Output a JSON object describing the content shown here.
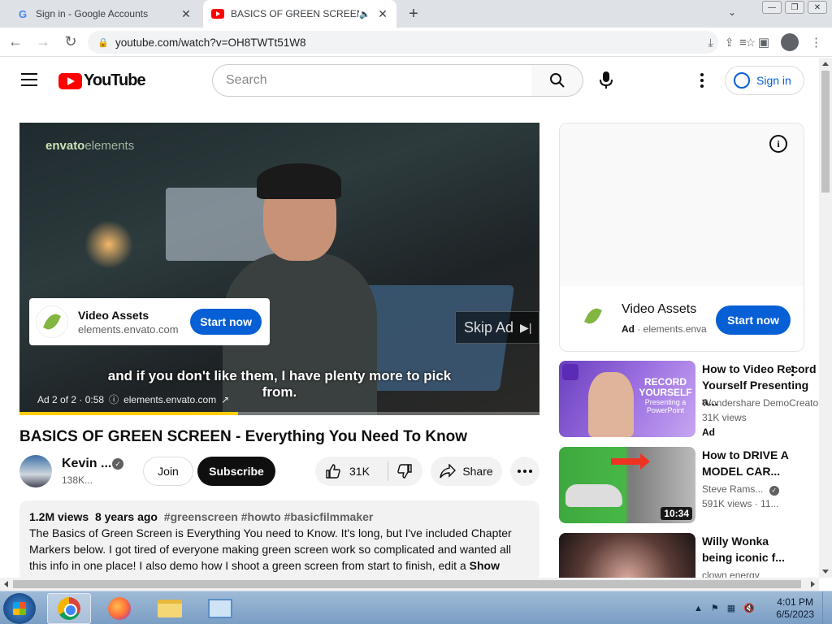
{
  "browser": {
    "tabs": [
      {
        "title": "Sign in - Google Accounts",
        "favicon": "google-g-icon"
      },
      {
        "title": "BASICS OF GREEN SCREEN -",
        "favicon": "youtube-icon",
        "audio": true
      }
    ],
    "url": "youtube.com/watch?v=OH8TWTt51W8"
  },
  "header": {
    "logo_text": "YouTube",
    "search_placeholder": "Search",
    "sign_in": "Sign in"
  },
  "player": {
    "brand_overlay": "envato",
    "brand_overlay_light": "elements",
    "ad_card": {
      "title": "Video Assets",
      "domain": "elements.envato.com",
      "cta": "Start now"
    },
    "skip_label": "Skip Ad",
    "caption_line1": "and if you don't like them, I have plenty more to pick",
    "caption_line2": "from.",
    "ad_status": "Ad 2 of 2 · 0:58",
    "ad_domain": "elements.envato.com",
    "progress": 0.42
  },
  "video": {
    "title": "BASICS OF GREEN SCREEN - Everything You Need To Know",
    "channel": "Kevin ...",
    "subscribers": "138K...",
    "join": "Join",
    "subscribe": "Subscribe",
    "likes": "31K",
    "share": "Share"
  },
  "description": {
    "views": "1.2M views",
    "age": "8 years ago",
    "tags": "#greenscreen #howto #basicfilmmaker",
    "line1": "The Basics of Green Screen is Everything You need to Know. It's long, but I've included Chapter",
    "line2": "Markers below. I got tired of everyone making green screen work so complicated and wanted all",
    "line3": "this info in one place!  I also demo how I shoot a green screen from start to finish, edit a",
    "show_more": "Show more"
  },
  "sidebar": {
    "ad": {
      "name": "Video Assets",
      "ad_label": "Ad",
      "domain": "elements.enva",
      "cta": "Start now",
      "info": "i"
    },
    "recommendations": [
      {
        "title_line1": "How to Video Record",
        "title_line2": "Yourself Presenting a...",
        "channel": "Wondershare DemoCreator",
        "views": "31K views",
        "ad": "Ad",
        "thumb_text": "RECORD YOURSELF",
        "thumb_sub": "Presenting a PowerPoint"
      },
      {
        "title_line1": "How to DRIVE A",
        "title_line2": "MODEL CAR...",
        "channel": "Steve Rams...",
        "views": "591K views · 11...",
        "duration": "10:34"
      },
      {
        "title_line1": "Willy Wonka",
        "title_line2": "being iconic f...",
        "channel": "clown energy"
      }
    ]
  },
  "taskbar": {
    "time": "4:01 PM",
    "date": "6/5/2023"
  }
}
